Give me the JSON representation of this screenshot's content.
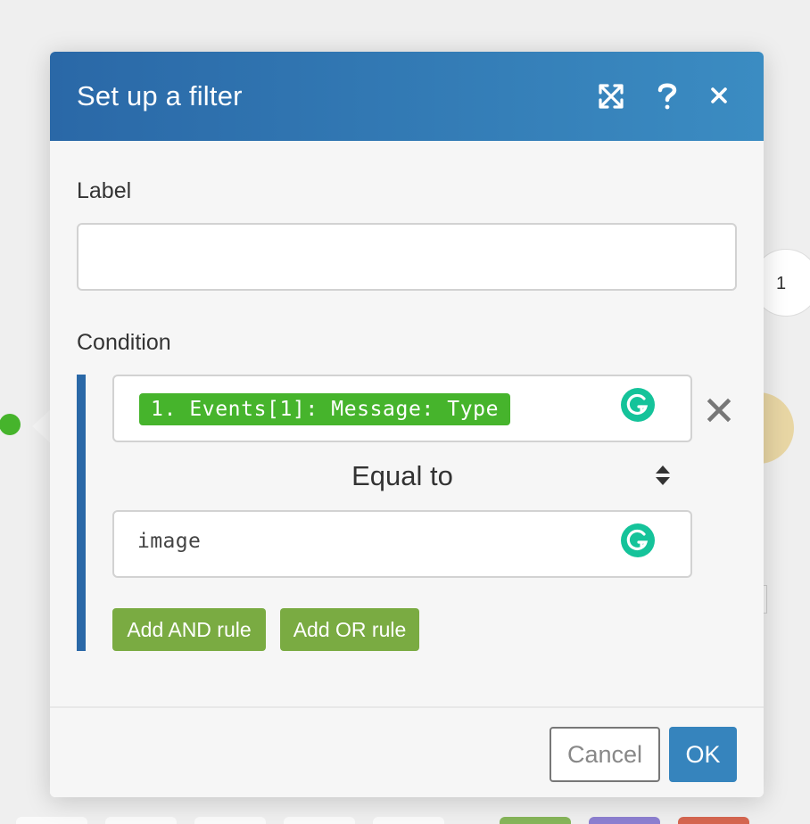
{
  "dialog": {
    "title": "Set up a filter",
    "header_icons": [
      "expand-icon",
      "help-icon",
      "close-icon"
    ]
  },
  "label_field": {
    "label": "Label",
    "value": ""
  },
  "condition": {
    "label": "Condition",
    "operand": "1. Events[1]: Message: Type",
    "operator": "Equal to",
    "value": "image",
    "add_and_label": "Add AND rule",
    "add_or_label": "Add OR rule"
  },
  "footer": {
    "cancel_label": "Cancel",
    "ok_label": "OK"
  },
  "background": {
    "module_number": "1"
  },
  "colors": {
    "header_start": "#2a68a7",
    "header_end": "#3b8cc2",
    "pill_green": "#46b42c",
    "rule_button_green": "#7aab42",
    "ok_blue": "#3684bd",
    "condition_bar": "#2a68a7",
    "grammarly": "#15c39a"
  }
}
